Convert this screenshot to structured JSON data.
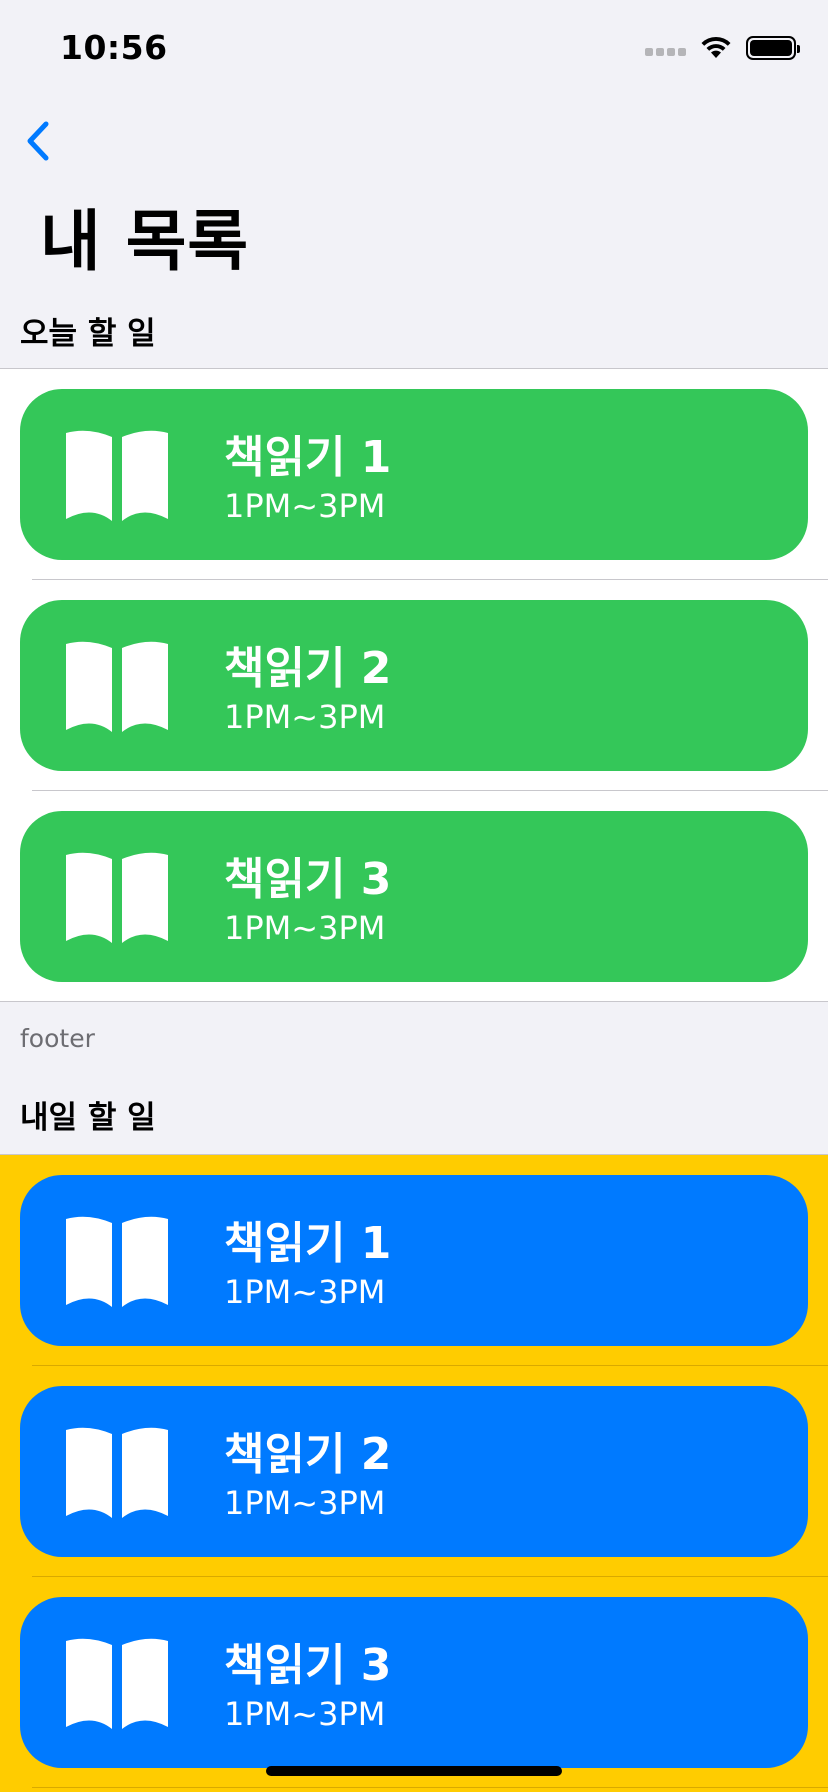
{
  "status_bar": {
    "time": "10:56"
  },
  "nav": {
    "title": "내 목록"
  },
  "sections": [
    {
      "header": "오늘 할 일",
      "footer": "footer",
      "card_color": "#34c759",
      "background": "#ffffff",
      "items": [
        {
          "title": "책읽기 1",
          "time": "1PM~3PM",
          "icon": "book-icon"
        },
        {
          "title": "책읽기 2",
          "time": "1PM~3PM",
          "icon": "book-icon"
        },
        {
          "title": "책읽기 3",
          "time": "1PM~3PM",
          "icon": "book-icon"
        }
      ]
    },
    {
      "header": "내일 할 일",
      "card_color": "#007aff",
      "background": "#ffcc00",
      "items": [
        {
          "title": "책읽기 1",
          "time": "1PM~3PM",
          "icon": "book-icon"
        },
        {
          "title": "책읽기 2",
          "time": "1PM~3PM",
          "icon": "book-icon"
        },
        {
          "title": "책읽기 3",
          "time": "1PM~3PM",
          "icon": "book-icon"
        }
      ]
    }
  ]
}
